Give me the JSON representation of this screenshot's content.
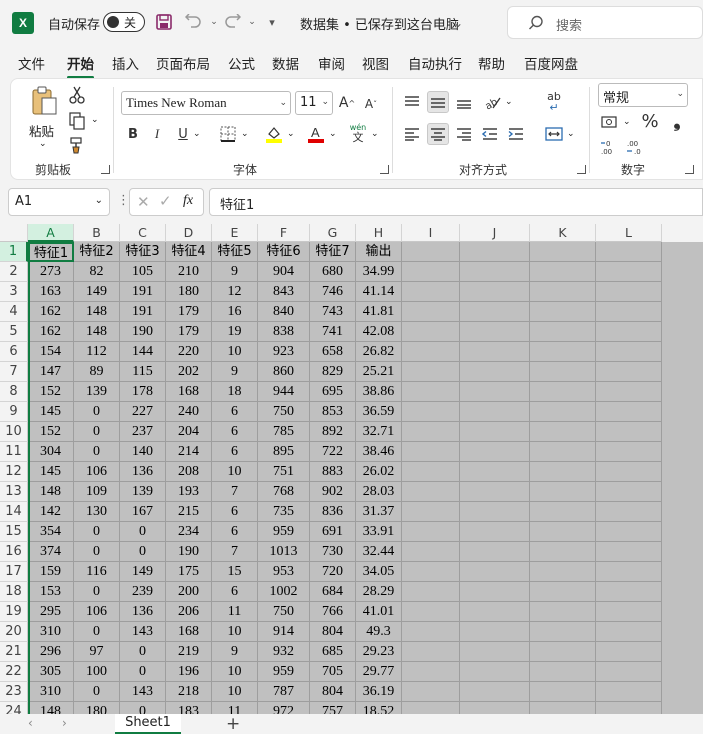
{
  "titlebar": {
    "autosave_label": "自动保存",
    "autosave_state": "关",
    "doc_title": "数据集 • 已保存到这台电脑",
    "search_placeholder": "搜索"
  },
  "menu": [
    "文件",
    "开始",
    "插入",
    "页面布局",
    "公式",
    "数据",
    "审阅",
    "视图",
    "自动执行",
    "帮助",
    "百度网盘"
  ],
  "menu_active": "开始",
  "ribbon": {
    "clipboard": {
      "paste": "粘贴",
      "label": "剪贴板"
    },
    "font": {
      "name": "Times New Roman",
      "size": "11",
      "label": "字体",
      "bold": "B",
      "italic": "I",
      "underline": "U",
      "wen": "wén",
      "wen_char": "文"
    },
    "align": {
      "label": "对齐方式",
      "wrap": "ab"
    },
    "number": {
      "format": "常规",
      "label": "数字",
      "percent": "%"
    }
  },
  "formula_bar": {
    "cell_ref": "A1",
    "fx": "fx",
    "value": "特征1"
  },
  "grid": {
    "columns": [
      "A",
      "B",
      "C",
      "D",
      "E",
      "F",
      "G",
      "H",
      "I",
      "J",
      "K",
      "L"
    ],
    "rows": [
      "1",
      "2",
      "3",
      "4",
      "5",
      "6",
      "7",
      "8",
      "9",
      "10",
      "11",
      "12",
      "13",
      "14",
      "15",
      "16",
      "17",
      "18",
      "19",
      "20",
      "21",
      "22",
      "23",
      "24"
    ],
    "data": [
      [
        "特征1",
        "特征2",
        "特征3",
        "特征4",
        "特征5",
        "特征6",
        "特征7",
        "输出"
      ],
      [
        "273",
        "82",
        "105",
        "210",
        "9",
        "904",
        "680",
        "34.99"
      ],
      [
        "163",
        "149",
        "191",
        "180",
        "12",
        "843",
        "746",
        "41.14"
      ],
      [
        "162",
        "148",
        "191",
        "179",
        "16",
        "840",
        "743",
        "41.81"
      ],
      [
        "162",
        "148",
        "190",
        "179",
        "19",
        "838",
        "741",
        "42.08"
      ],
      [
        "154",
        "112",
        "144",
        "220",
        "10",
        "923",
        "658",
        "26.82"
      ],
      [
        "147",
        "89",
        "115",
        "202",
        "9",
        "860",
        "829",
        "25.21"
      ],
      [
        "152",
        "139",
        "178",
        "168",
        "18",
        "944",
        "695",
        "38.86"
      ],
      [
        "145",
        "0",
        "227",
        "240",
        "6",
        "750",
        "853",
        "36.59"
      ],
      [
        "152",
        "0",
        "237",
        "204",
        "6",
        "785",
        "892",
        "32.71"
      ],
      [
        "304",
        "0",
        "140",
        "214",
        "6",
        "895",
        "722",
        "38.46"
      ],
      [
        "145",
        "106",
        "136",
        "208",
        "10",
        "751",
        "883",
        "26.02"
      ],
      [
        "148",
        "109",
        "139",
        "193",
        "7",
        "768",
        "902",
        "28.03"
      ],
      [
        "142",
        "130",
        "167",
        "215",
        "6",
        "735",
        "836",
        "31.37"
      ],
      [
        "354",
        "0",
        "0",
        "234",
        "6",
        "959",
        "691",
        "33.91"
      ],
      [
        "374",
        "0",
        "0",
        "190",
        "7",
        "1013",
        "730",
        "32.44"
      ],
      [
        "159",
        "116",
        "149",
        "175",
        "15",
        "953",
        "720",
        "34.05"
      ],
      [
        "153",
        "0",
        "239",
        "200",
        "6",
        "1002",
        "684",
        "28.29"
      ],
      [
        "295",
        "106",
        "136",
        "206",
        "11",
        "750",
        "766",
        "41.01"
      ],
      [
        "310",
        "0",
        "143",
        "168",
        "10",
        "914",
        "804",
        "49.3"
      ],
      [
        "296",
        "97",
        "0",
        "219",
        "9",
        "932",
        "685",
        "29.23"
      ],
      [
        "305",
        "100",
        "0",
        "196",
        "10",
        "959",
        "705",
        "29.77"
      ],
      [
        "310",
        "0",
        "143",
        "218",
        "10",
        "787",
        "804",
        "36.19"
      ],
      [
        "148",
        "180",
        "0",
        "183",
        "11",
        "972",
        "757",
        "18.52"
      ]
    ]
  },
  "sheet_tab": "Sheet1",
  "add_sheet": "+"
}
